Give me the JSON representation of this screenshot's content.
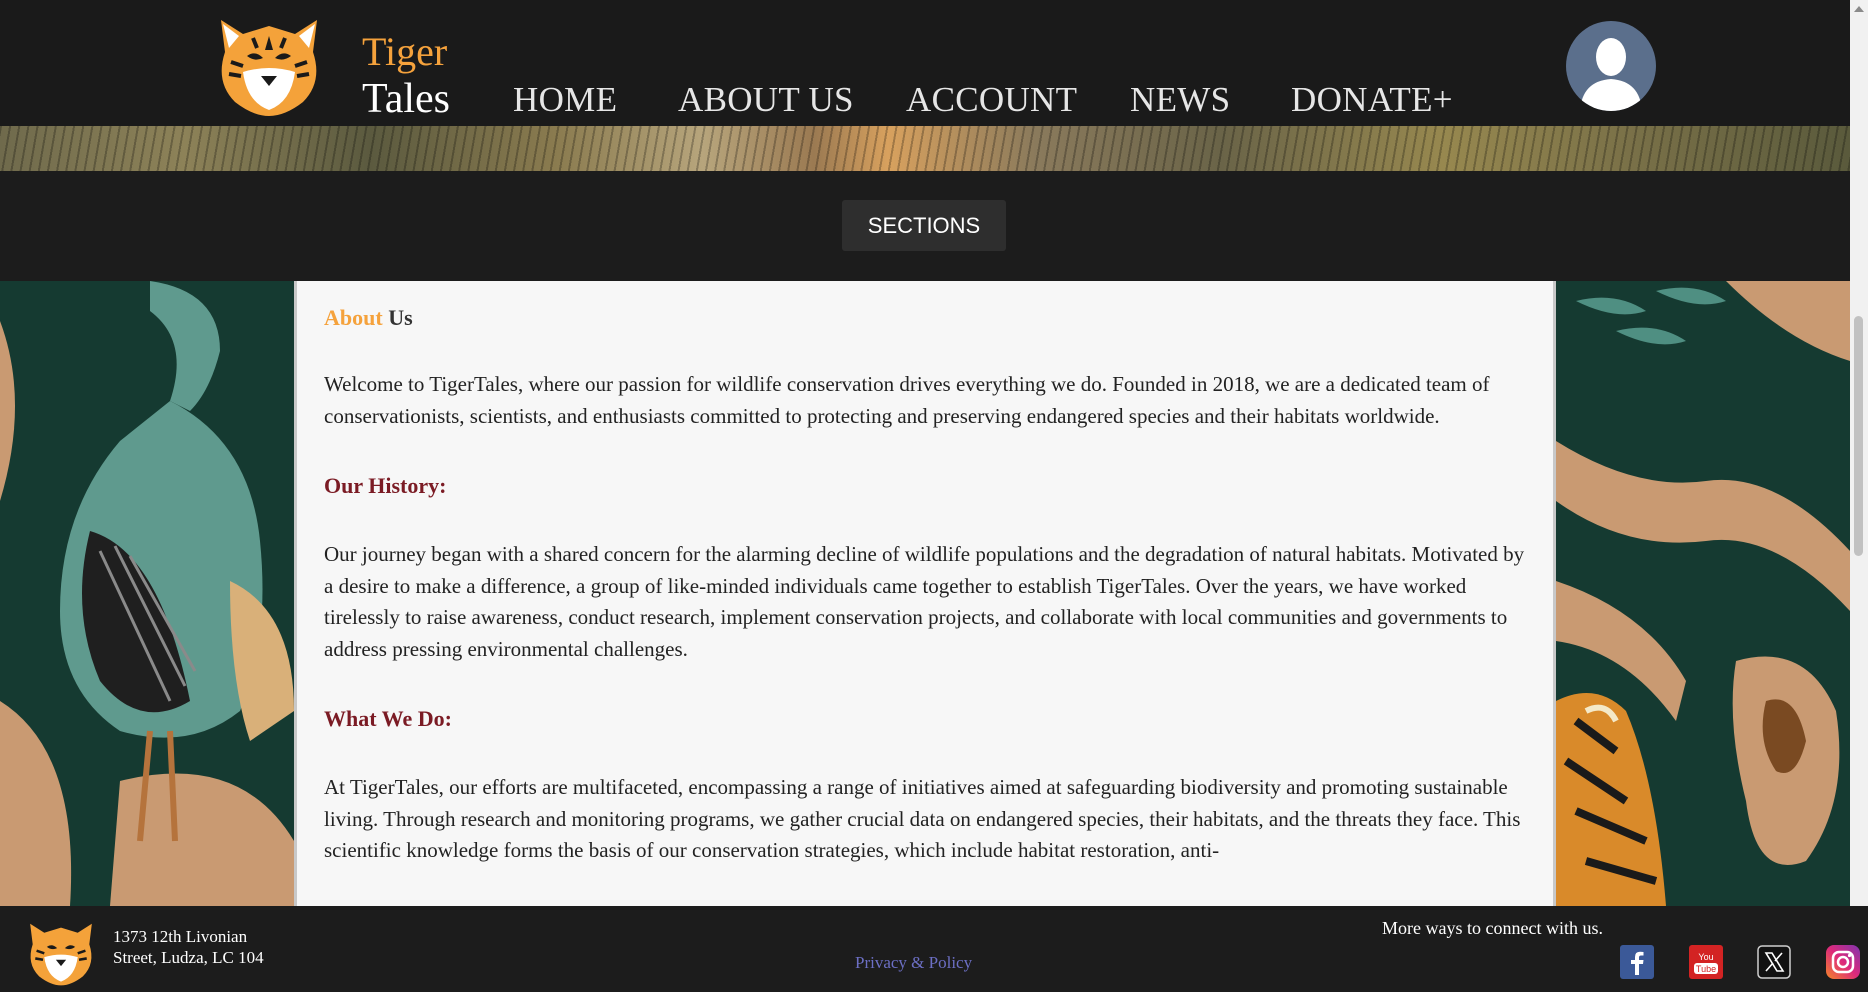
{
  "header": {
    "brand_line1": "Tiger",
    "brand_line2": "Tales",
    "nav": [
      {
        "label": "HOME"
      },
      {
        "label": "ABOUT US"
      },
      {
        "label": "ACCOUNT"
      },
      {
        "label": "NEWS"
      },
      {
        "label": "DONATE+"
      }
    ],
    "avatar_icon": "user-icon"
  },
  "sections_button": "SECTIONS",
  "content": {
    "title_accent": "About",
    "title_rest": " Us",
    "intro": "Welcome to TigerTales, where our passion for wildlife conservation drives everything we do. Founded in 2018, we are a dedicated team of conservationists, scientists, and enthusiasts committed to protecting and preserving endangered species and their habitats worldwide.",
    "history_heading": "Our History:",
    "history": "Our journey began with a shared concern for the alarming decline of wildlife populations and the degradation of natural habitats. Motivated by a desire to make a difference, a group of like-minded individuals came together to establish TigerTales. Over the years, we have worked tirelessly to raise awareness, conduct research, implement conservation projects, and collaborate with local communities and governments to address pressing environmental challenges.",
    "whatwedo_heading": "What We Do:",
    "whatwedo": "At TigerTales, our efforts are multifaceted, encompassing a range of initiatives aimed at safeguarding biodiversity and promoting sustainable living. Through research and monitoring programs, we gather crucial data on endangered species, their habitats, and the threats they face. This scientific knowledge forms the basis of our conservation strategies, which include habitat restoration, anti-"
  },
  "footer": {
    "address_line1": "1373 12th Livonian",
    "address_line2": "Street, Ludza, LC 104",
    "privacy": "Privacy & Policy",
    "connect": "More ways to connect with us.",
    "social_icons": [
      "facebook-icon",
      "youtube-icon",
      "x-icon",
      "instagram-icon"
    ]
  },
  "colors": {
    "accent": "#f5a23c",
    "heading": "#7b1b24",
    "background": "#1c1c1c",
    "link": "#6c6fc4"
  }
}
